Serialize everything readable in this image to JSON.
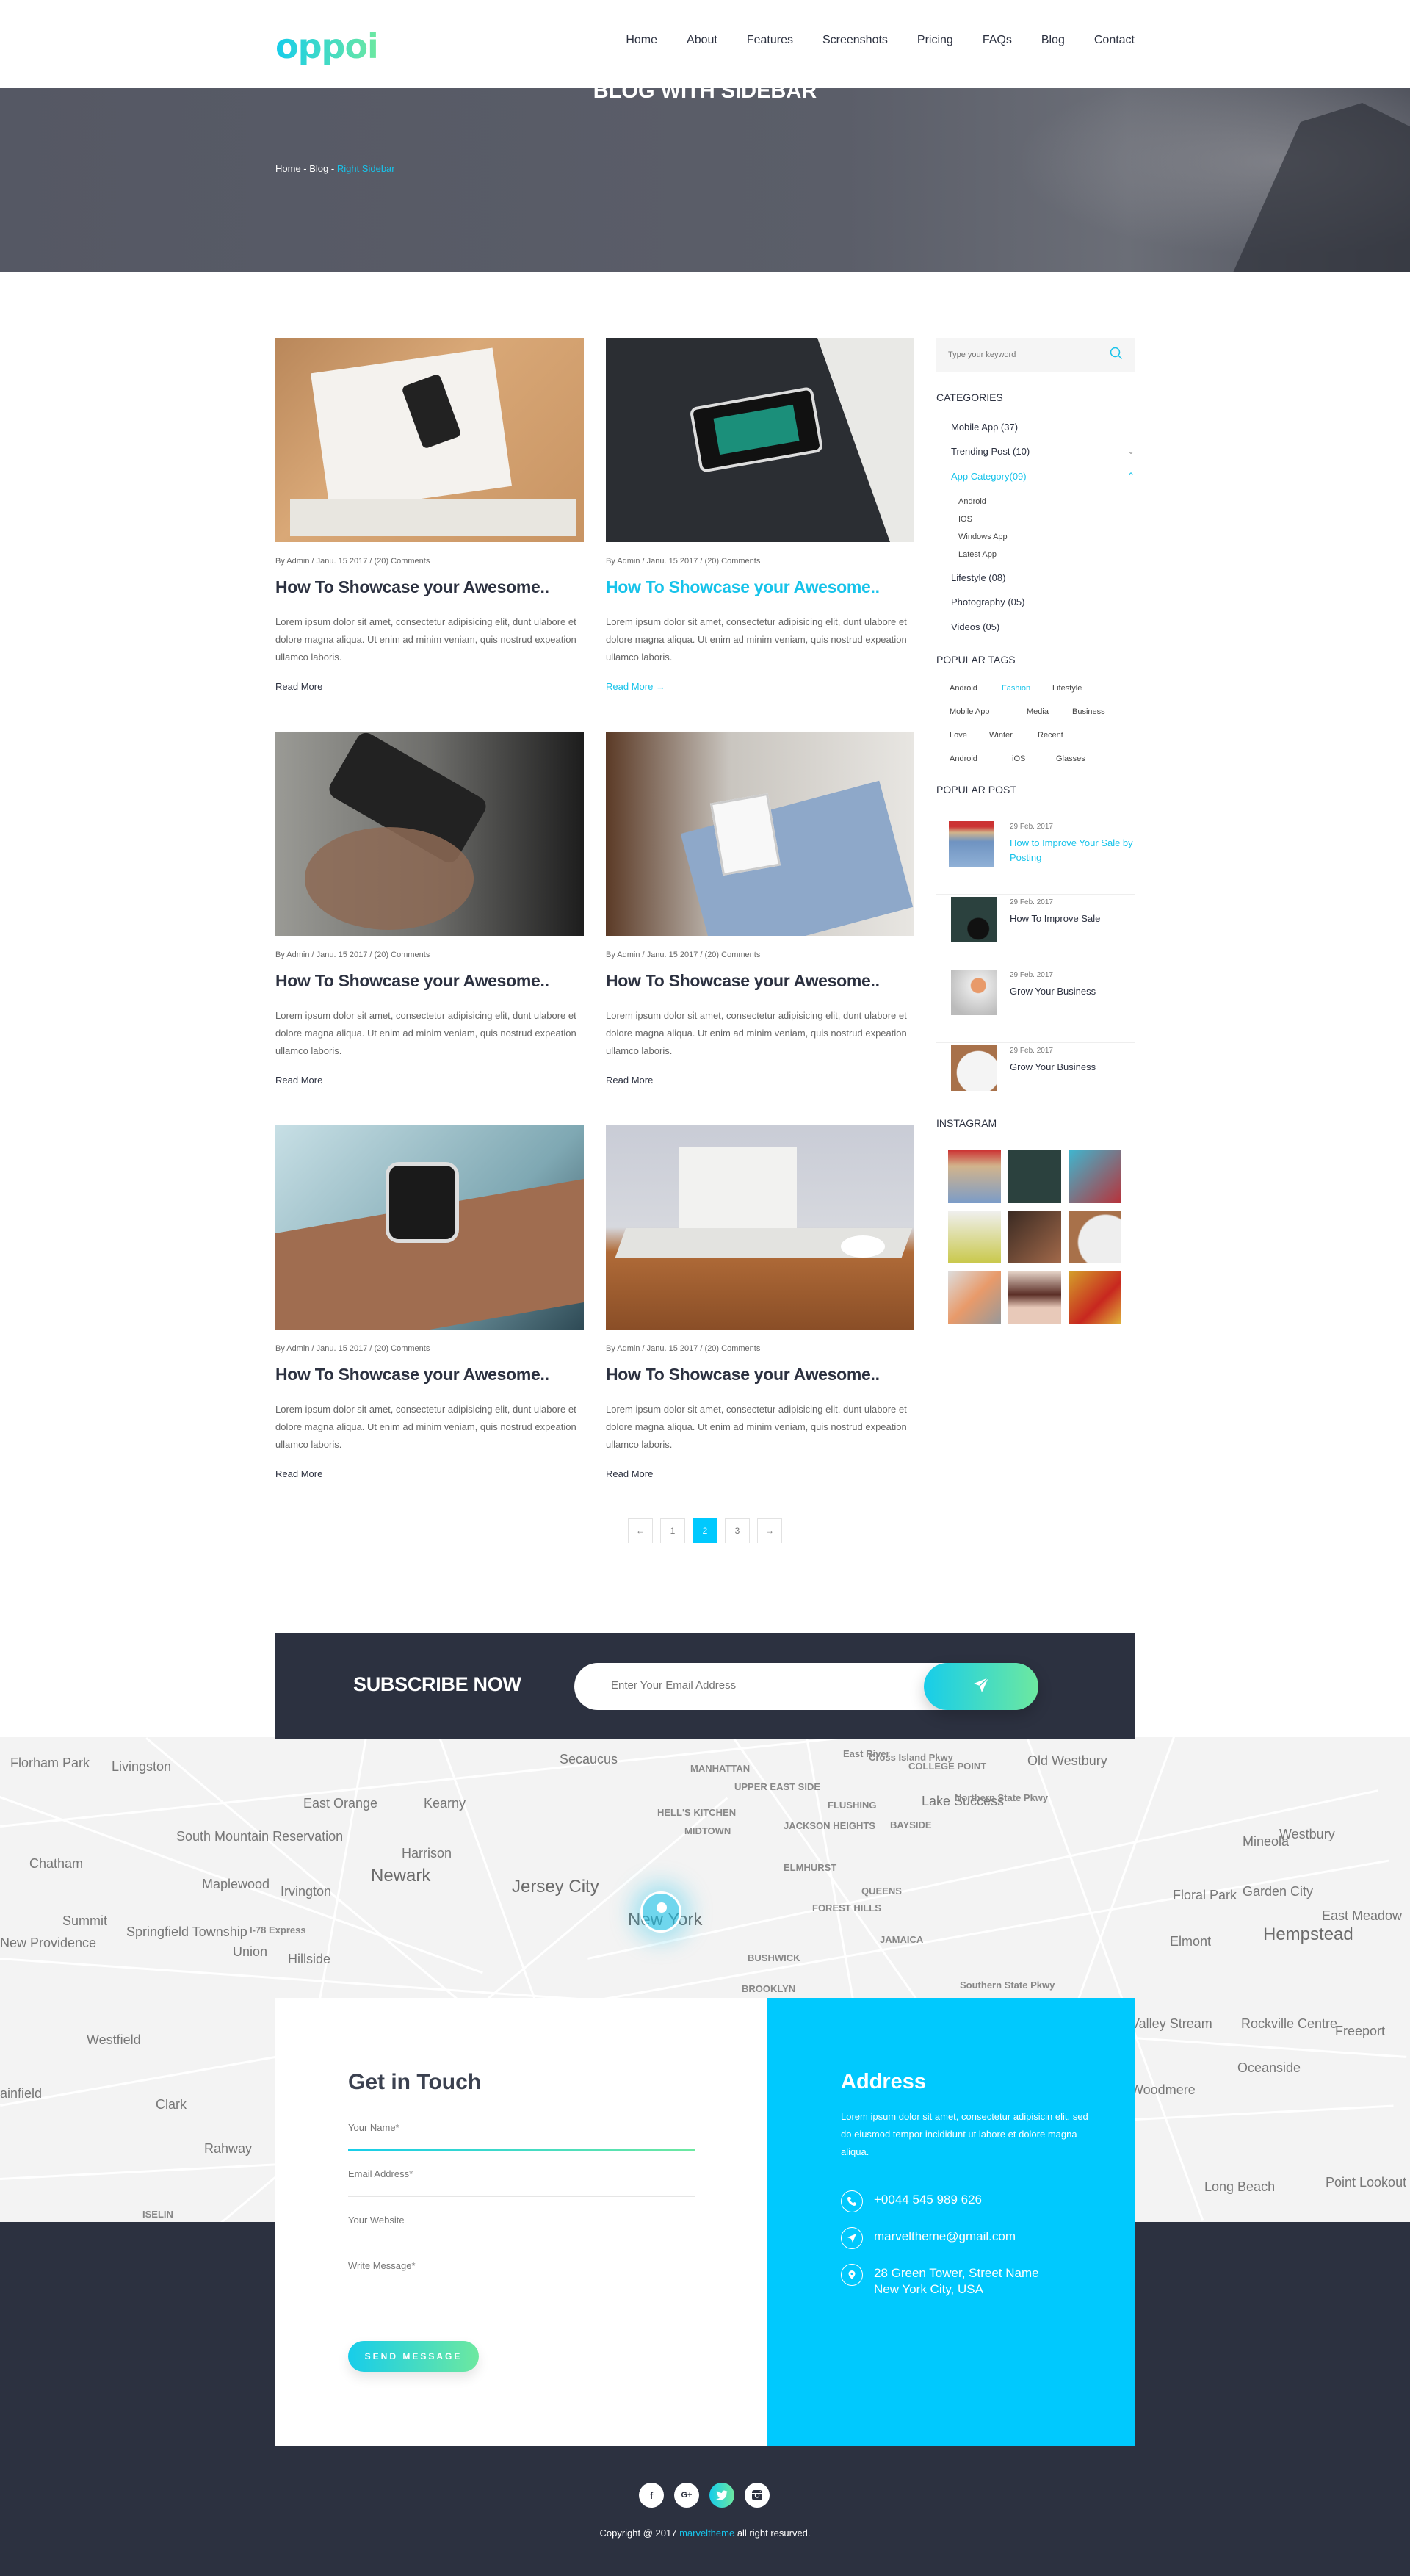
{
  "header": {
    "logo": "oppoi",
    "nav": [
      "Home",
      "About",
      "Features",
      "Screenshots",
      "Pricing",
      "FAQs",
      "Blog",
      "Contact"
    ]
  },
  "banner": {
    "title": "BLOG WITH SIDEBAR",
    "breadcrumb": {
      "home": "Home",
      "sep": " - ",
      "blog": "Blog",
      "current": "Right Sidebar"
    }
  },
  "posts": [
    {
      "meta": "By Admin  /  Janu. 15 2017  /  (20) Comments",
      "title": "How To Showcase your Awesome..",
      "excerpt": "Lorem ipsum dolor sit amet, consectetur adipisicing elit, dunt ulabore et dolore magna aliqua. Ut enim ad minim veniam, quis nostrud expeation ullamco laboris.",
      "more": "Read More",
      "image": "desk-with-phone-photo"
    },
    {
      "meta": "By Admin  /  Janu. 15 2017  /  (20) Comments",
      "title": "How To Showcase your Awesome..",
      "excerpt": "Lorem ipsum dolor sit amet, consectetur adipisicing elit, dunt ulabore et dolore magna aliqua. Ut enim ad minim veniam, quis nostrud expeation ullamco laboris.",
      "more": "Read More",
      "more_arrow": "→",
      "active": true,
      "image": "phone-earbuds-photo"
    },
    {
      "meta": "By Admin  /  Janu. 15 2017  /  (20) Comments",
      "title": "How To Showcase your Awesome..",
      "excerpt": "Lorem ipsum dolor sit amet, consectetur adipisicing elit, dunt ulabore et dolore magna aliqua. Ut enim ad minim veniam, quis nostrud expeation ullamco laboris.",
      "more": "Read More",
      "image": "hand-holding-phone-photo"
    },
    {
      "meta": "By Admin  /  Janu. 15 2017  /  (20) Comments",
      "title": "How To Showcase your Awesome..",
      "excerpt": "Lorem ipsum dolor sit amet, consectetur adipisicing elit, dunt ulabore et dolore magna aliqua. Ut enim ad minim veniam, quis nostrud expeation ullamco laboris.",
      "more": "Read More",
      "image": "man-with-tablet-photo"
    },
    {
      "meta": "By Admin  /  Janu. 15 2017  /  (20) Comments",
      "title": "How To Showcase your Awesome..",
      "excerpt": "Lorem ipsum dolor sit amet, consectetur adipisicing elit, dunt ulabore et dolore magna aliqua. Ut enim ad minim veniam, quis nostrud expeation ullamco laboris.",
      "more": "Read More",
      "image": "smartwatch-photo"
    },
    {
      "meta": "By Admin  /  Janu. 15 2017  /  (20) Comments",
      "title": "How To Showcase your Awesome..",
      "excerpt": "Lorem ipsum dolor sit amet, consectetur adipisicing elit, dunt ulabore et dolore magna aliqua. Ut enim ad minim veniam, quis nostrud expeation ullamco laboris.",
      "more": "Read More",
      "image": "glasses-laptop-photo"
    }
  ],
  "pagination": {
    "prev": "←",
    "pages": [
      "1",
      "2",
      "3"
    ],
    "current": "2",
    "next": "→"
  },
  "sidebar": {
    "search_placeholder": "Type your keyword",
    "categories_title": "CATEGORIES",
    "categories": [
      {
        "label": "Mobile App (37)"
      },
      {
        "label": "Trending Post (10)",
        "toggle": "⌄"
      },
      {
        "label": "App Category(09)",
        "toggle": "⌃",
        "active": true,
        "children": [
          "Android",
          "IOS",
          "Windows App",
          "Latest App"
        ]
      },
      {
        "label": "Lifestyle (08)"
      },
      {
        "label": "Photography (05)"
      },
      {
        "label": "Videos (05)"
      }
    ],
    "tags_title": "POPULAR TAGS",
    "tags": [
      "Android",
      "Fashion",
      "Lifestyle",
      "Mobile App",
      "Media",
      "Business",
      "Love",
      "Winter",
      "Recent",
      "Android",
      "iOS",
      "Glasses"
    ],
    "active_tag": "Fashion",
    "popular_title": "POPULAR POST",
    "popular": [
      {
        "date": "29 Feb. 2017",
        "title": "How to Improve Your Sale by Posting",
        "active": true
      },
      {
        "date": "29 Feb. 2017",
        "title": "How To Improve Sale"
      },
      {
        "date": "29 Feb. 2017",
        "title": "Grow Your Business"
      },
      {
        "date": "29 Feb. 2017",
        "title": "Grow Your Business"
      }
    ],
    "instagram_title": "INSTAGRAM"
  },
  "subscribe": {
    "label": "SUBSCRIBE NOW",
    "placeholder": "Enter Your Email Address"
  },
  "map": {
    "labels": [
      "Florham Park",
      "Livingston",
      "Secaucus",
      "MANHATTAN",
      "UPPER EAST SIDE",
      "HELL'S KITCHEN",
      "MIDTOWN",
      "East River",
      "COLLEGE POINT",
      "FLUSHING",
      "Cross Island Pkwy",
      "Lake Success",
      "Northern State Pkwy",
      "Old Westbury",
      "East Orange",
      "Kearny",
      "South Mountain Reservation",
      "Chatham",
      "Harrison",
      "Newark",
      "Maplewood",
      "Irvington",
      "Jersey City",
      "JACKSON HEIGHTS",
      "ELMHURST",
      "BAYSIDE",
      "QUEENS",
      "Mineola",
      "Westbury",
      "Summit",
      "Springfield Township",
      "I-78 Express",
      "Union",
      "Hillside",
      "New Providence",
      "New York",
      "FOREST HILLS",
      "Floral Park",
      "Garden City",
      "JAMAICA",
      "Elmont",
      "Hempstead",
      "East Meadow",
      "BUSHWICK",
      "BROOKLYN",
      "Southern State Pkwy",
      "Westfield",
      "Clark",
      "Rahway",
      "ainfield",
      "ISELIN",
      "Valley Stream",
      "Rockville Centre",
      "Freeport",
      "Oceanside",
      "Woodmere",
      "Long Beach",
      "Point Lookout"
    ]
  },
  "contact": {
    "title": "Get in Touch",
    "fields": {
      "name": "Your Name*",
      "email": "Email Address*",
      "website": "Your Website",
      "message": "Write Message*"
    },
    "send": "SEND MESSAGE"
  },
  "address": {
    "title": "Address",
    "desc": "Lorem ipsum dolor sit amet, consectetur adipisicin elit, sed do eiusmod tempor incididunt ut labore et dolore magna aliqua.",
    "phone": "+0044 545 989 626",
    "email": "marveltheme@gmail.com",
    "location_line1": "28 Green Tower, Street Name",
    "location_line2": "New York City, USA"
  },
  "footer": {
    "social": [
      "f",
      "G+",
      "twitter",
      "instagram"
    ],
    "copyright_pre": "Copyright @ 2017 ",
    "brand": "marveltheme",
    "copyright_post": " all right resurved."
  },
  "colors": {
    "accent": "#00c9fe",
    "link": "#17c3ea",
    "dark": "#2c3140",
    "gradient_start": "#17cdea",
    "gradient_end": "#6de8a0"
  }
}
